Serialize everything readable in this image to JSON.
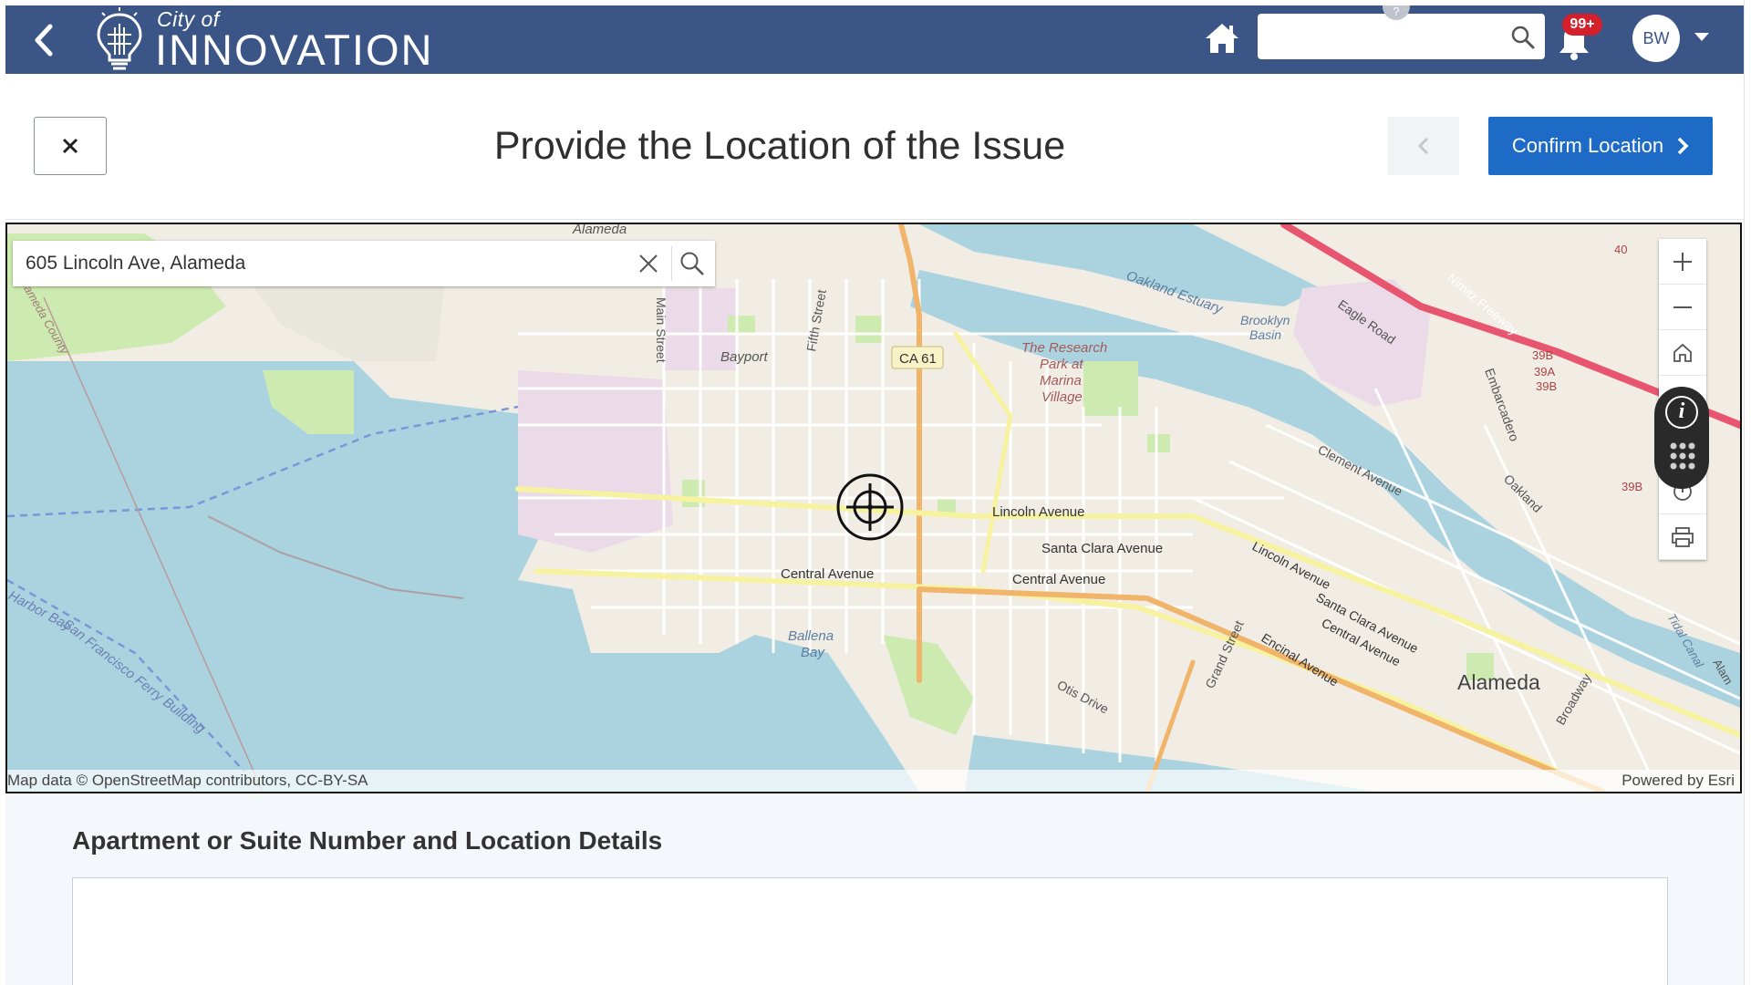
{
  "header": {
    "logo_small": "City of",
    "logo_big": "INNOVATION",
    "search_placeholder": "",
    "help_label": "?",
    "notifications_badge": "99+",
    "avatar_initials": "BW"
  },
  "page": {
    "title": "Provide the Location of the Issue",
    "close_label": "×",
    "confirm_label": "Confirm Location"
  },
  "map": {
    "search_value": "605 Lincoln Ave, Alameda",
    "attribution": "Map data © OpenStreetMap contributors, CC-BY-SA",
    "powered_by": "Powered by Esri",
    "labels": {
      "alameda_top": "Alameda",
      "main_street": "Main Street",
      "fifth_street": "Fifth Street",
      "bayport": "Bayport",
      "ca61": "CA 61",
      "research_park_1": "The Research",
      "research_park_2": "Park at",
      "research_park_3": "Marina",
      "research_park_4": "Village",
      "oakland_estuary": "Oakland Estuary",
      "brooklyn_1": "Brooklyn",
      "brooklyn_2": "Basin",
      "eagle_road": "Eagle Road",
      "nimitz": "Nimitz Freeway",
      "embarcadero": "Embarcadero",
      "oakland": "Oakland",
      "lincoln_avenue": "Lincoln Avenue",
      "santa_clara_avenue": "Santa Clara Avenue",
      "central_avenue_left": "Central Avenue",
      "central_avenue_mid": "Central Avenue",
      "clement_avenue": "Clement Avenue",
      "lincoln_avenue_2": "Lincoln Avenue",
      "santa_clara_2": "Santa Clara Avenue",
      "central_avenue_2": "Central Avenue",
      "encinal_avenue": "Encinal Avenue",
      "grand_street": "Grand Street",
      "otis_drive": "Otis Drive",
      "broadway": "Broadway",
      "ballena_1": "Ballena",
      "ballena_2": "Bay",
      "alameda_city": "Alameda",
      "ferry": "San Francisco Ferry Building",
      "harbor_bay": "Harbor Bay",
      "alameda_county": "Alameda County",
      "hwy_40": "40",
      "hwy_39b": "39B",
      "hwy_39a": "39A",
      "hwy_39b_2": "39B",
      "hwy_39b_3": "39B",
      "tidal": "Tidal Canal",
      "alam_right": "Alam"
    }
  },
  "details": {
    "label": "Apartment or Suite Number and Location Details",
    "value": ""
  },
  "colors": {
    "topbar": "#3a5586",
    "confirm": "#1d6ac7",
    "badge": "#d3202a",
    "water": "#aad3df",
    "park": "#cdebb0",
    "land": "#f1ede5"
  },
  "icons": [
    "back-icon",
    "bulb-logo-icon",
    "home-icon",
    "search-icon",
    "bell-icon",
    "chevron-down-icon",
    "close-icon",
    "chevron-left-icon",
    "chevron-right-icon",
    "clear-icon",
    "zoom-in-icon",
    "zoom-out-icon",
    "home-extent-icon",
    "info-icon",
    "grid-icon",
    "layers-icon",
    "print-icon",
    "crosshair-icon"
  ]
}
